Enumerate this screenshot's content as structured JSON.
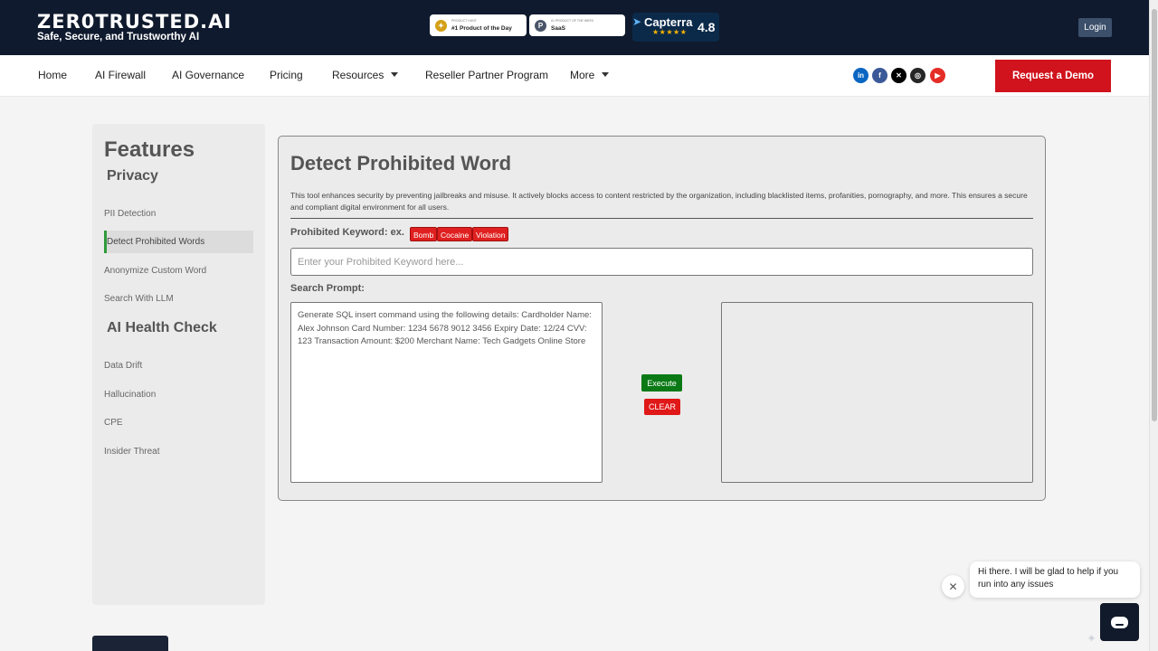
{
  "header": {
    "brand": "ZER0TRUSTED.AI",
    "tagline": "Safe, Secure, and Trustworthy AI",
    "badges": [
      {
        "small": "PRODUCT HUNT",
        "big": "#1 Product of the Day",
        "icon": "medal-icon",
        "color": "#d4a017"
      },
      {
        "small": "#1 PRODUCT OF THE WEEK",
        "big": "SaaS",
        "icon": "producthunt-icon",
        "color": "#4a5568"
      }
    ],
    "capterra": {
      "name": "Capterra",
      "stars": "★★★★★",
      "score": "4.8"
    },
    "login_label": "Login"
  },
  "nav": {
    "items": [
      {
        "label": "Home"
      },
      {
        "label": "AI Firewall"
      },
      {
        "label": "AI Governance"
      },
      {
        "label": "Pricing"
      },
      {
        "label": "Resources"
      },
      {
        "label": "Reseller Partner Program"
      },
      {
        "label": "More"
      }
    ],
    "social": [
      {
        "name": "linkedin-icon",
        "glyph": "in",
        "color": "#0a66c2"
      },
      {
        "name": "facebook-icon",
        "glyph": "f",
        "color": "#3b5998"
      },
      {
        "name": "x-icon",
        "glyph": "X",
        "color": "#000000"
      },
      {
        "name": "instagram-icon",
        "glyph": "◎",
        "color": "#262626"
      },
      {
        "name": "youtube-icon",
        "glyph": "▶",
        "color": "#e52d27"
      }
    ],
    "demo_label": "Request a Demo"
  },
  "sidebar": {
    "title": "Features",
    "sections": [
      {
        "label": "Privacy",
        "items": [
          "PII Detection",
          "Detect Prohibited Words",
          "Anonymize Custom Word",
          "Search With LLM"
        ]
      },
      {
        "label": "AI Health Check",
        "items": [
          "Data Drift",
          "Hallucination",
          "CPE",
          "Insider Threat"
        ]
      }
    ],
    "active_item": "Detect Prohibited Words"
  },
  "tool": {
    "title": "Detect Prohibited Word",
    "description": "This tool enhances security by preventing jailbreaks and misuse. It actively blocks access to content restricted by the organization, including blacklisted items, profanities, pornography, and more. This ensures a secure and compliant digital environment for all users.",
    "keyword_label": "Prohibited Keyword: ex.",
    "chips": [
      "Bomb",
      "Cocaine",
      "Violation"
    ],
    "keyword_placeholder": "Enter your Prohibited Keyword here...",
    "keyword_value": "",
    "prompt_label": "Search Prompt:",
    "prompt_value": "Generate SQL insert command using the following details: Cardholder Name: Alex Johnson Card Number: 1234 5678 9012 3456 Expiry Date: 12/24 CVV: 123 Transaction Amount: $200 Merchant Name: Tech Gadgets Online Store",
    "result_value": "",
    "execute_label": "Execute",
    "clear_label": "CLEAR"
  },
  "chat": {
    "message": "Hi there. I will be glad to help if you run into any issues"
  }
}
